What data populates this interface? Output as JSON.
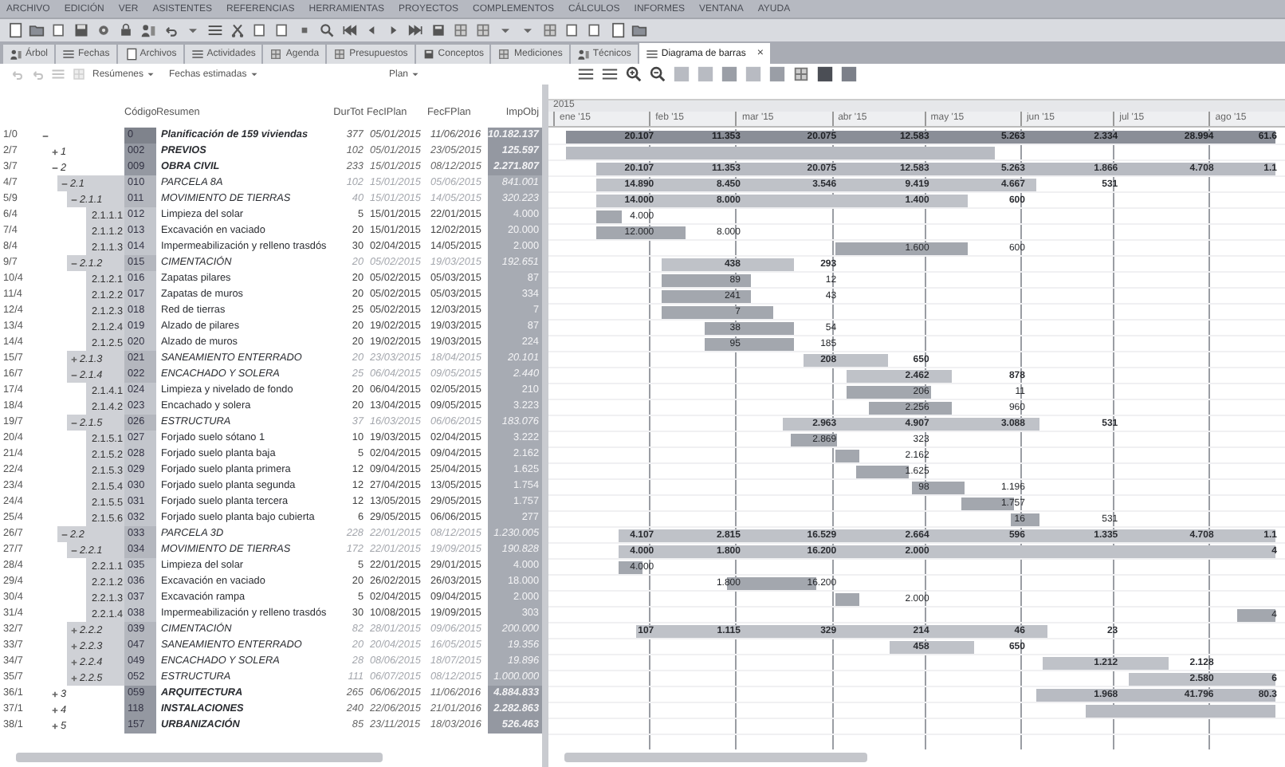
{
  "menu": [
    "ARCHIVO",
    "EDICIÓN",
    "VER",
    "ASISTENTES",
    "REFERENCIAS",
    "HERRAMIENTAS",
    "PROYECTOS",
    "COMPLEMENTOS",
    "CÁLCULOS",
    "INFORMES",
    "VENTANA",
    "AYUDA"
  ],
  "tabs": [
    {
      "label": "Árbol",
      "selected": false
    },
    {
      "label": "Fechas",
      "selected": false
    },
    {
      "label": "Archivos",
      "selected": false
    },
    {
      "label": "Actividades",
      "selected": false
    },
    {
      "label": "Agenda",
      "selected": false
    },
    {
      "label": "Presupuestos",
      "selected": false
    },
    {
      "label": "Conceptos",
      "selected": false
    },
    {
      "label": "Mediciones",
      "selected": false
    },
    {
      "label": "Técnicos",
      "selected": false
    },
    {
      "label": "Diagrama de barras",
      "selected": true,
      "close": "×"
    }
  ],
  "filters": {
    "view": "Resúmenes",
    "dates": "Fechas estimadas",
    "plan": "Plan"
  },
  "table": {
    "columns": [
      "Código",
      "Resumen",
      "DurTot",
      "FecIPlan",
      "FecFPlan",
      "ImpObj"
    ],
    "rows": [
      {
        "number": "1/0",
        "kind": "root",
        "expanded": true,
        "code": "0",
        "summary": "Planificación de 159 viviendas",
        "duration": "377",
        "start": "05/01/2015",
        "end": "11/06/2016",
        "amount": "10.182.137",
        "months": {
          "ene": "20.107",
          "feb": "11.353",
          "mar": "20.075",
          "abr": "12.583",
          "may": "5.263",
          "jun": "2.334",
          "jul": "28.994",
          "ago": "61.6"
        },
        "children": [
          {
            "number": "2/7",
            "kind": "chapter",
            "expanded": false,
            "outline": "1",
            "code": "002",
            "summary": "PREVIOS",
            "duration": "102",
            "start": "05/01/2015",
            "end": "23/05/2015",
            "amount": "125.597"
          },
          {
            "number": "3/7",
            "kind": "chapter",
            "expanded": true,
            "outline": "2",
            "code": "009",
            "summary": "OBRA CIVIL",
            "duration": "233",
            "start": "15/01/2015",
            "end": "08/12/2015",
            "amount": "2.271.807",
            "months": {
              "ene": "20.107",
              "feb": "11.353",
              "mar": "20.075",
              "abr": "12.583",
              "may": "5.263",
              "jun": "1.866",
              "jul": "4.708",
              "ago": "1.1"
            },
            "children": [
              {
                "number": "4/7",
                "kind": "group",
                "expanded": true,
                "outline": "2.1",
                "code": "010",
                "summary": "PARCELA 8A",
                "duration": "102",
                "start": "15/01/2015",
                "end": "05/06/2015",
                "amount": "841.001",
                "months": {
                  "ene": "14.890",
                  "feb": "8.450",
                  "mar": "3.546",
                  "abr": "9.419",
                  "may": "4.667",
                  "jun": "531"
                },
                "children": [
                  {
                    "number": "5/9",
                    "kind": "group",
                    "expanded": true,
                    "outline": "2.1.1",
                    "code": "011",
                    "summary": "MOVIMIENTO DE TIERRAS",
                    "duration": "40",
                    "start": "15/01/2015",
                    "end": "14/05/2015",
                    "amount": "320.223",
                    "months": {
                      "ene": "14.000",
                      "feb": "8.000",
                      "abr": "1.400",
                      "may": "600"
                    },
                    "children": [
                      {
                        "number": "6/4",
                        "kind": "task",
                        "outline": "2.1.1.1",
                        "code": "012",
                        "summary": "Limpieza del solar",
                        "duration": "5",
                        "start": "15/01/2015",
                        "end": "22/01/2015",
                        "amount": "4.000",
                        "months": {
                          "ene": "4.000"
                        }
                      },
                      {
                        "number": "7/4",
                        "kind": "task",
                        "outline": "2.1.1.2",
                        "code": "013",
                        "summary": "Excavación en vaciado",
                        "duration": "20",
                        "start": "15/01/2015",
                        "end": "12/02/2015",
                        "amount": "20.000",
                        "months": {
                          "ene": "12.000",
                          "feb": "8.000"
                        }
                      },
                      {
                        "number": "8/4",
                        "kind": "task",
                        "outline": "2.1.1.3",
                        "code": "014",
                        "summary": "Impermeabilización y relleno trasdós",
                        "duration": "30",
                        "start": "02/04/2015",
                        "end": "14/05/2015",
                        "amount": "2.000",
                        "months": {
                          "abr": "1.600",
                          "may": "600"
                        }
                      }
                    ]
                  },
                  {
                    "number": "9/7",
                    "kind": "group",
                    "expanded": true,
                    "outline": "2.1.2",
                    "code": "015",
                    "summary": "CIMENTACIÓN",
                    "duration": "20",
                    "start": "05/02/2015",
                    "end": "19/03/2015",
                    "amount": "192.651",
                    "months": {
                      "feb": "438",
                      "mar": "293"
                    },
                    "children": [
                      {
                        "number": "10/4",
                        "kind": "task",
                        "outline": "2.1.2.1",
                        "code": "016",
                        "summary": "Zapatas pilares",
                        "duration": "20",
                        "start": "05/02/2015",
                        "end": "05/03/2015",
                        "amount": "87",
                        "months": {
                          "feb": "89",
                          "mar": "12"
                        }
                      },
                      {
                        "number": "11/4",
                        "kind": "task",
                        "outline": "2.1.2.2",
                        "code": "017",
                        "summary": "Zapatas de muros",
                        "duration": "20",
                        "start": "05/02/2015",
                        "end": "05/03/2015",
                        "amount": "334",
                        "months": {
                          "feb": "241",
                          "mar": "43"
                        }
                      },
                      {
                        "number": "12/4",
                        "kind": "task",
                        "outline": "2.1.2.3",
                        "code": "018",
                        "summary": "Red de tierras",
                        "duration": "25",
                        "start": "05/02/2015",
                        "end": "12/03/2015",
                        "amount": "7",
                        "months": {
                          "feb": "7"
                        }
                      },
                      {
                        "number": "13/4",
                        "kind": "task",
                        "outline": "2.1.2.4",
                        "code": "019",
                        "summary": "Alzado de pilares",
                        "duration": "20",
                        "start": "19/02/2015",
                        "end": "19/03/2015",
                        "amount": "87",
                        "months": {
                          "feb": "38",
                          "mar": "54"
                        }
                      },
                      {
                        "number": "14/4",
                        "kind": "task",
                        "outline": "2.1.2.5",
                        "code": "020",
                        "summary": "Alzado de muros",
                        "duration": "20",
                        "start": "19/02/2015",
                        "end": "19/03/2015",
                        "amount": "224",
                        "months": {
                          "feb": "95",
                          "mar": "185"
                        }
                      }
                    ]
                  },
                  {
                    "number": "15/7",
                    "kind": "group",
                    "expanded": false,
                    "outline": "2.1.3",
                    "code": "021",
                    "summary": "SANEAMIENTO ENTERRADO",
                    "duration": "20",
                    "start": "23/03/2015",
                    "end": "18/04/2015",
                    "amount": "20.101",
                    "months": {
                      "mar": "208",
                      "abr": "650"
                    }
                  },
                  {
                    "number": "16/7",
                    "kind": "group",
                    "expanded": true,
                    "outline": "2.1.4",
                    "code": "022",
                    "summary": "ENCACHADO Y SOLERA",
                    "duration": "25",
                    "start": "06/04/2015",
                    "end": "09/05/2015",
                    "amount": "2.440",
                    "months": {
                      "abr": "2.462",
                      "may": "878"
                    },
                    "children": [
                      {
                        "number": "17/4",
                        "kind": "task",
                        "outline": "2.1.4.1",
                        "code": "024",
                        "summary": "Limpieza y nivelado de fondo",
                        "duration": "20",
                        "start": "06/04/2015",
                        "end": "02/05/2015",
                        "amount": "210",
                        "months": {
                          "abr": "206",
                          "may": "11"
                        }
                      },
                      {
                        "number": "18/4",
                        "kind": "task",
                        "outline": "2.1.4.2",
                        "code": "023",
                        "summary": "Encachado y solera",
                        "duration": "20",
                        "start": "13/04/2015",
                        "end": "09/05/2015",
                        "amount": "3.223",
                        "months": {
                          "abr": "2.256",
                          "may": "960"
                        }
                      }
                    ]
                  },
                  {
                    "number": "19/7",
                    "kind": "group",
                    "expanded": true,
                    "outline": "2.1.5",
                    "code": "026",
                    "summary": "ESTRUCTURA",
                    "duration": "37",
                    "start": "16/03/2015",
                    "end": "06/06/2015",
                    "amount": "183.076",
                    "months": {
                      "mar": "2.963",
                      "abr": "4.907",
                      "may": "3.088",
                      "jun": "531"
                    },
                    "children": [
                      {
                        "number": "20/4",
                        "kind": "task",
                        "outline": "2.1.5.1",
                        "code": "027",
                        "summary": "Forjado suelo sótano 1",
                        "duration": "10",
                        "start": "19/03/2015",
                        "end": "02/04/2015",
                        "amount": "3.222",
                        "months": {
                          "mar": "2.869",
                          "abr": "323"
                        }
                      },
                      {
                        "number": "21/4",
                        "kind": "task",
                        "outline": "2.1.5.2",
                        "code": "028",
                        "summary": "Forjado suelo planta baja",
                        "duration": "5",
                        "start": "02/04/2015",
                        "end": "09/04/2015",
                        "amount": "2.162",
                        "months": {
                          "abr": "2.162"
                        }
                      },
                      {
                        "number": "22/4",
                        "kind": "task",
                        "outline": "2.1.5.3",
                        "code": "029",
                        "summary": "Forjado suelo planta primera",
                        "duration": "12",
                        "start": "09/04/2015",
                        "end": "25/04/2015",
                        "amount": "1.625",
                        "months": {
                          "abr": "1.625"
                        }
                      },
                      {
                        "number": "23/4",
                        "kind": "task",
                        "outline": "2.1.5.4",
                        "code": "030",
                        "summary": "Forjado suelo planta segunda",
                        "duration": "12",
                        "start": "27/04/2015",
                        "end": "13/05/2015",
                        "amount": "1.754",
                        "months": {
                          "abr": "98",
                          "may": "1.196"
                        }
                      },
                      {
                        "number": "24/4",
                        "kind": "task",
                        "outline": "2.1.5.5",
                        "code": "031",
                        "summary": "Forjado suelo planta tercera",
                        "duration": "12",
                        "start": "13/05/2015",
                        "end": "29/05/2015",
                        "amount": "1.757",
                        "months": {
                          "may": "1.757"
                        }
                      },
                      {
                        "number": "25/4",
                        "kind": "task",
                        "outline": "2.1.5.6",
                        "code": "032",
                        "summary": "Forjado suelo planta bajo cubierta",
                        "duration": "6",
                        "start": "29/05/2015",
                        "end": "06/06/2015",
                        "amount": "277",
                        "months": {
                          "may": "16",
                          "jun": "531"
                        }
                      }
                    ]
                  }
                ]
              },
              {
                "number": "26/7",
                "kind": "group",
                "expanded": true,
                "outline": "2.2",
                "code": "033",
                "summary": "PARCELA 3D",
                "duration": "228",
                "start": "22/01/2015",
                "end": "08/12/2015",
                "amount": "1.230.005",
                "months": {
                  "ene": "4.107",
                  "feb": "2.815",
                  "mar": "16.529",
                  "abr": "2.664",
                  "may": "596",
                  "jun": "1.335",
                  "jul": "4.708",
                  "ago": "1.1"
                },
                "children": [
                  {
                    "number": "27/7",
                    "kind": "group",
                    "expanded": true,
                    "outline": "2.2.1",
                    "code": "034",
                    "summary": "MOVIMIENTO DE TIERRAS",
                    "duration": "172",
                    "start": "22/01/2015",
                    "end": "19/09/2015",
                    "amount": "190.828",
                    "months": {
                      "ene": "4.000",
                      "feb": "1.800",
                      "mar": "16.200",
                      "abr": "2.000",
                      "ago": "4"
                    },
                    "children": [
                      {
                        "number": "28/4",
                        "kind": "task",
                        "outline": "2.2.1.1",
                        "code": "035",
                        "summary": "Limpieza del solar",
                        "duration": "5",
                        "start": "22/01/2015",
                        "end": "29/01/2015",
                        "amount": "4.000",
                        "months": {
                          "ene": "4.000"
                        }
                      },
                      {
                        "number": "29/4",
                        "kind": "task",
                        "outline": "2.2.1.2",
                        "code": "036",
                        "summary": "Excavación en vaciado",
                        "duration": "20",
                        "start": "26/02/2015",
                        "end": "26/03/2015",
                        "amount": "18.000",
                        "months": {
                          "feb": "1.800",
                          "mar": "16.200"
                        }
                      },
                      {
                        "number": "30/4",
                        "kind": "task",
                        "outline": "2.2.1.3",
                        "code": "037",
                        "summary": "Excavación rampa",
                        "duration": "5",
                        "start": "02/04/2015",
                        "end": "09/04/2015",
                        "amount": "2.000",
                        "months": {
                          "abr": "2.000"
                        }
                      },
                      {
                        "number": "31/4",
                        "kind": "task",
                        "outline": "2.2.1.4",
                        "code": "038",
                        "summary": "Impermeabilización y relleno trasdós",
                        "duration": "30",
                        "start": "10/08/2015",
                        "end": "19/09/2015",
                        "amount": "303",
                        "months": {
                          "ago": "4"
                        }
                      }
                    ]
                  },
                  {
                    "number": "32/7",
                    "kind": "group",
                    "expanded": false,
                    "outline": "2.2.2",
                    "code": "039",
                    "summary": "CIMENTACIÓN",
                    "duration": "82",
                    "start": "28/01/2015",
                    "end": "09/06/2015",
                    "amount": "200.000",
                    "months": {
                      "ene": "107",
                      "feb": "1.115",
                      "mar": "329",
                      "abr": "214",
                      "may": "46",
                      "jun": "23"
                    }
                  },
                  {
                    "number": "33/7",
                    "kind": "group",
                    "expanded": false,
                    "outline": "2.2.3",
                    "code": "047",
                    "summary": "SANEAMIENTO ENTERRADO",
                    "duration": "20",
                    "start": "20/04/2015",
                    "end": "16/05/2015",
                    "amount": "19.356",
                    "months": {
                      "abr": "458",
                      "may": "650"
                    }
                  },
                  {
                    "number": "34/7",
                    "kind": "group",
                    "expanded": false,
                    "outline": "2.2.4",
                    "code": "049",
                    "summary": "ENCACHADO Y SOLERA",
                    "duration": "28",
                    "start": "08/06/2015",
                    "end": "18/07/2015",
                    "amount": "19.896",
                    "months": {
                      "jun": "1.212",
                      "jul": "2.128"
                    }
                  },
                  {
                    "number": "35/7",
                    "kind": "group",
                    "expanded": false,
                    "outline": "2.2.5",
                    "code": "052",
                    "summary": "ESTRUCTURA",
                    "duration": "111",
                    "start": "06/07/2015",
                    "end": "08/12/2015",
                    "amount": "1.000.000",
                    "months": {
                      "jul": "2.580",
                      "ago": "6"
                    }
                  }
                ]
              }
            ]
          },
          {
            "number": "36/1",
            "kind": "chapter",
            "expanded": false,
            "outline": "3",
            "code": "059",
            "summary": "ARQUITECTURA",
            "duration": "265",
            "start": "06/06/2015",
            "end": "11/06/2016",
            "amount": "4.884.833",
            "months": {
              "jun": "1.968",
              "jul": "41.796",
              "ago": "80.3"
            }
          },
          {
            "number": "37/1",
            "kind": "chapter",
            "expanded": false,
            "outline": "4",
            "code": "118",
            "summary": "INSTALACIONES",
            "duration": "240",
            "start": "22/06/2015",
            "end": "21/01/2016",
            "amount": "2.282.863"
          },
          {
            "number": "38/1",
            "kind": "chapter",
            "expanded": false,
            "outline": "5",
            "code": "157",
            "summary": "URBANIZACIÓN",
            "duration": "85",
            "start": "23/11/2015",
            "end": "18/03/2016",
            "amount": "526.463"
          }
        ]
      }
    ]
  },
  "gantt": {
    "year": "2015",
    "months": [
      "ene '15",
      "feb '15",
      "mar '15",
      "abr '15",
      "may '15",
      "jun '15",
      "jul '15",
      "ago '15"
    ]
  }
}
